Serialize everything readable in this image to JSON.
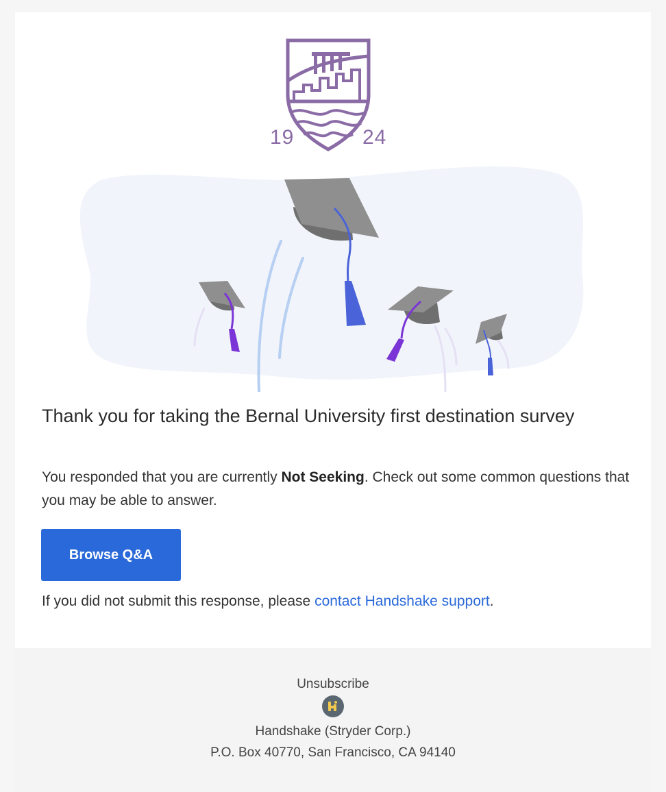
{
  "crest": {
    "year_left": "19",
    "year_right": "24",
    "color": "#8a6ba6"
  },
  "hero": {
    "illustration": "graduation-caps-illustration"
  },
  "message": {
    "headline": "Thank you for taking the Bernal University first destination survey",
    "body_prefix": "You responded that you are currently ",
    "status": "Not Seeking",
    "body_suffix": ". Check out some common questions that you may be able to answer.",
    "button_label": "Browse Q&A",
    "note_prefix": "If you did not submit this response, please ",
    "note_link": "contact Handshake support",
    "note_suffix": "."
  },
  "footer": {
    "unsubscribe": "Unsubscribe",
    "logo_icon": "handshake-logo-icon",
    "company": "Handshake (Stryder Corp.)",
    "address": "P.O. Box 40770, San Francisco, CA 94140"
  },
  "colors": {
    "accent": "#2a69d9",
    "background": "#f6f6f6",
    "card": "#ffffff"
  }
}
